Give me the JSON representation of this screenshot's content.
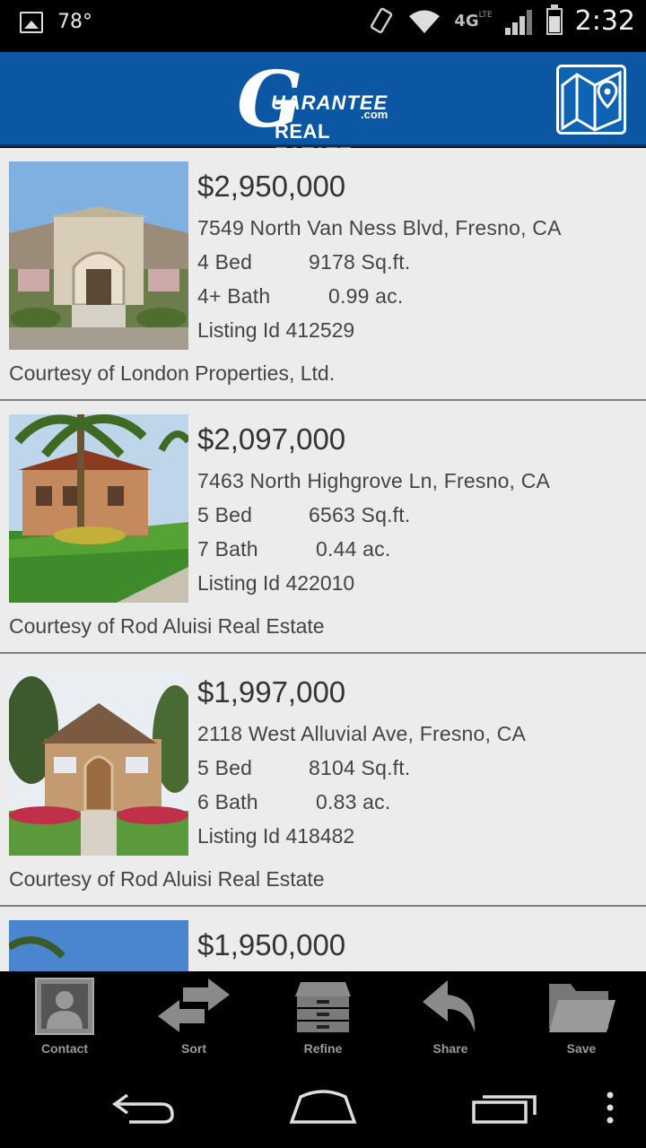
{
  "status_bar": {
    "temperature": "78°",
    "network": "4G",
    "network_sub": "LTE",
    "time": "2:32"
  },
  "header": {
    "logo_g": "G",
    "logo_line1": "UARANTEE",
    "logo_com": ".com",
    "logo_line2": "REAL ESTATE",
    "map_icon": "map-location-icon"
  },
  "listings": [
    {
      "price": "$2,950,000",
      "address": "7549 North Van Ness Blvd, Fresno, CA",
      "beds": "4 Bed",
      "sqft": "9178 Sq.ft.",
      "baths": "4+ Bath",
      "acres": "0.99 ac.",
      "listing_id": "Listing Id 412529",
      "courtesy": "Courtesy of London Properties, Ltd."
    },
    {
      "price": "$2,097,000",
      "address": "7463 North Highgrove Ln, Fresno, CA",
      "beds": "5 Bed",
      "sqft": "6563 Sq.ft.",
      "baths": "7 Bath",
      "acres": "0.44 ac.",
      "listing_id": "Listing Id 422010",
      "courtesy": "Courtesy of Rod Aluisi Real Estate"
    },
    {
      "price": "$1,997,000",
      "address": "2118 West Alluvial Ave, Fresno, CA",
      "beds": "5 Bed",
      "sqft": "8104 Sq.ft.",
      "baths": "6 Bath",
      "acres": "0.83 ac.",
      "listing_id": "Listing Id 418482",
      "courtesy": "Courtesy of Rod Aluisi Real Estate"
    },
    {
      "price": "$1,950,000"
    }
  ],
  "toolbar": {
    "contact": "Contact",
    "sort": "Sort",
    "refine": "Refine",
    "share": "Share",
    "save": "Save"
  },
  "colors": {
    "header_blue": "#0b57a4",
    "list_bg": "#ececec",
    "toolbar_bg": "#000000"
  }
}
